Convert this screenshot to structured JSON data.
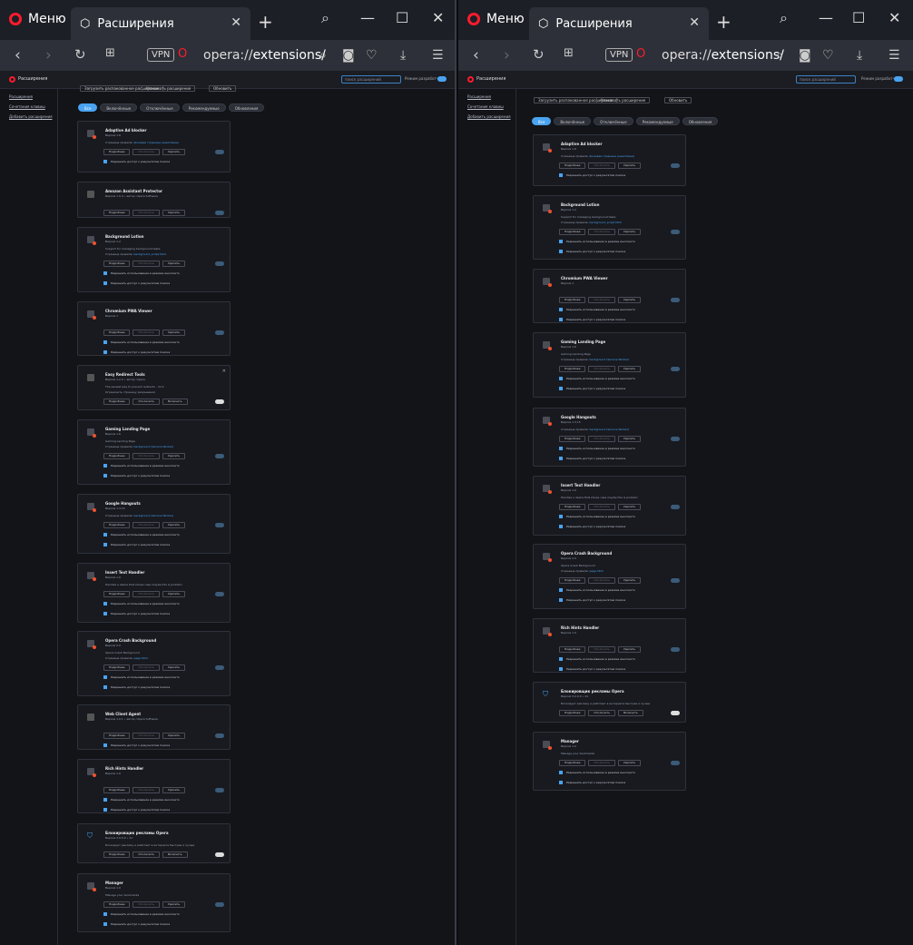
{
  "browser": {
    "menu": "Меню",
    "tab_title": "Расширения",
    "url_prefix": "opera://",
    "url_rest": "extensions/",
    "vpn": "VPN"
  },
  "page": {
    "title": "Расширения",
    "search_placeholder": "поиск расширений",
    "dev_mode": "Режим разработчика"
  },
  "sidebar": [
    "Расширения",
    "Сочетания клавиш",
    "Добавить расширения"
  ],
  "toolbar": {
    "load": "Загрузить распакованное расширение",
    "pack": "Упаковать расширение",
    "update": "Обновить"
  },
  "filters": [
    "Все",
    "Включённые",
    "Отключённые",
    "Рекомендуемые",
    "Обновления"
  ],
  "labels": {
    "details": "Подробнее",
    "disable": "Отключить",
    "enable": "Включить",
    "remove": "Удалить",
    "incognito": "Разрешить использование в режиме инкогнито",
    "fileurls": "Разрешить доступ к результатам поиска",
    "owner": "Страница правила:",
    "bg": "фоновая страница (неактивна)",
    "bg2": "background_script.html",
    "bg3": "background (Service Worker)",
    "bg4": "page.html"
  },
  "left_cards": [
    {
      "name": "Adaptive Ad blocker",
      "ver": "Версия 1.6",
      "lines": []
    },
    {
      "name": "Amazon Assistant Protector",
      "ver": "Версия 1.0.4 • автор: Opera Software",
      "lines": []
    },
    {
      "name": "Background Lotion",
      "ver": "Версия 1.2",
      "lines": [
        "Support for managing background tasks"
      ]
    },
    {
      "name": "Chromium PWA Viewer",
      "ver": "Версия 1",
      "lines": []
    },
    {
      "name": "Easy Redirect Tools",
      "ver": "Версия 1.2.0 • автор: Opera",
      "lines": [
        "The easiest way to prevent redirects - click",
        "Ограничить страницу разрешения"
      ]
    },
    {
      "name": "Gaming Landing Page",
      "ver": "Версия 1.6",
      "lines": [
        "Gaming Landing Page"
      ]
    },
    {
      "name": "Google Hangouts",
      "ver": "Версия 1.3.15",
      "lines": []
    },
    {
      "name": "Insert Text Handler",
      "ver": "Версия 1.0",
      "lines": [
        "Handles a desire that shows case maybe this is problem"
      ]
    },
    {
      "name": "Opera Crash Background",
      "ver": "Версия 2.0",
      "lines": [
        "Opera Crash Background"
      ]
    },
    {
      "name": "Web Client Agent",
      "ver": "Версия 1.0.1 • автор: Opera Software",
      "lines": []
    },
    {
      "name": "Rich Hints Handler",
      "ver": "Версия 1.0",
      "lines": []
    },
    {
      "name": "Блокировщик рекламы Opera",
      "ver": "Версия 3.0.0.0 • 21",
      "lines": [
        "Блокирует рекламу и работает в интернете быстрее и лучше"
      ]
    },
    {
      "name": "Manager",
      "ver": "Версия 1.0",
      "lines": [
        "Manage your bookmarks"
      ]
    }
  ],
  "right_cards": [
    {
      "name": "Adaptive Ad blocker",
      "ver": "Версия 1.6",
      "lines": []
    },
    {
      "name": "Background Lotion",
      "ver": "Версия 1.2",
      "lines": [
        "Support for managing background tasks"
      ]
    },
    {
      "name": "Chromium PWA Viewer",
      "ver": "Версия 1",
      "lines": []
    },
    {
      "name": "Gaming Landing Page",
      "ver": "Версия 1.6",
      "lines": [
        "Gaming Landing Page"
      ]
    },
    {
      "name": "Google Hangouts",
      "ver": "Версия 1.3.15",
      "lines": []
    },
    {
      "name": "Insert Text Handler",
      "ver": "Версия 1.0",
      "lines": [
        "Handles a desire that shows case maybe this is problem"
      ]
    },
    {
      "name": "Opera Crash Background",
      "ver": "Версия 2.0",
      "lines": [
        "Opera Crash Background"
      ]
    },
    {
      "name": "Rich Hints Handler",
      "ver": "Версия 1.0",
      "lines": []
    },
    {
      "name": "Блокировщик рекламы Opera",
      "ver": "Версия 3.0.0.0 • 21",
      "lines": [
        "Блокирует рекламу и работает в интернете быстрее и лучше"
      ]
    },
    {
      "name": "Manager",
      "ver": "Версия 1.0",
      "lines": [
        "Manage your bookmarks"
      ]
    }
  ]
}
